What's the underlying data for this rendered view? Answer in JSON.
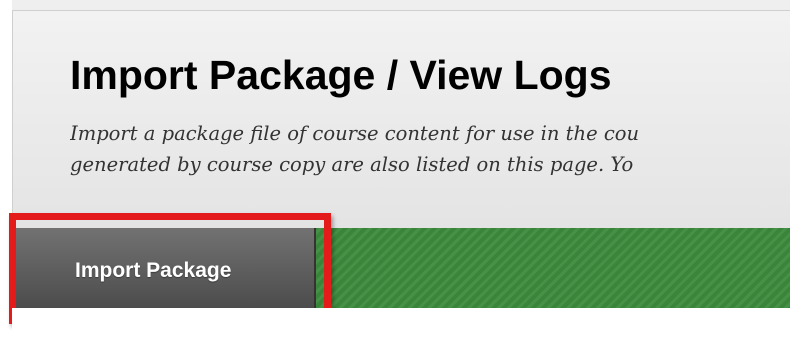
{
  "page": {
    "title": "Import Package / View Logs",
    "description_lines": [
      "Import a package file of course content for use in the cou",
      "generated by course copy are also listed on this page. Yo"
    ]
  },
  "action_bar": {
    "import_button_label": "Import Package"
  },
  "colors": {
    "action_bar": "#3b8a3c",
    "button": "#5e5e5e",
    "highlight": "#e41b1b"
  }
}
